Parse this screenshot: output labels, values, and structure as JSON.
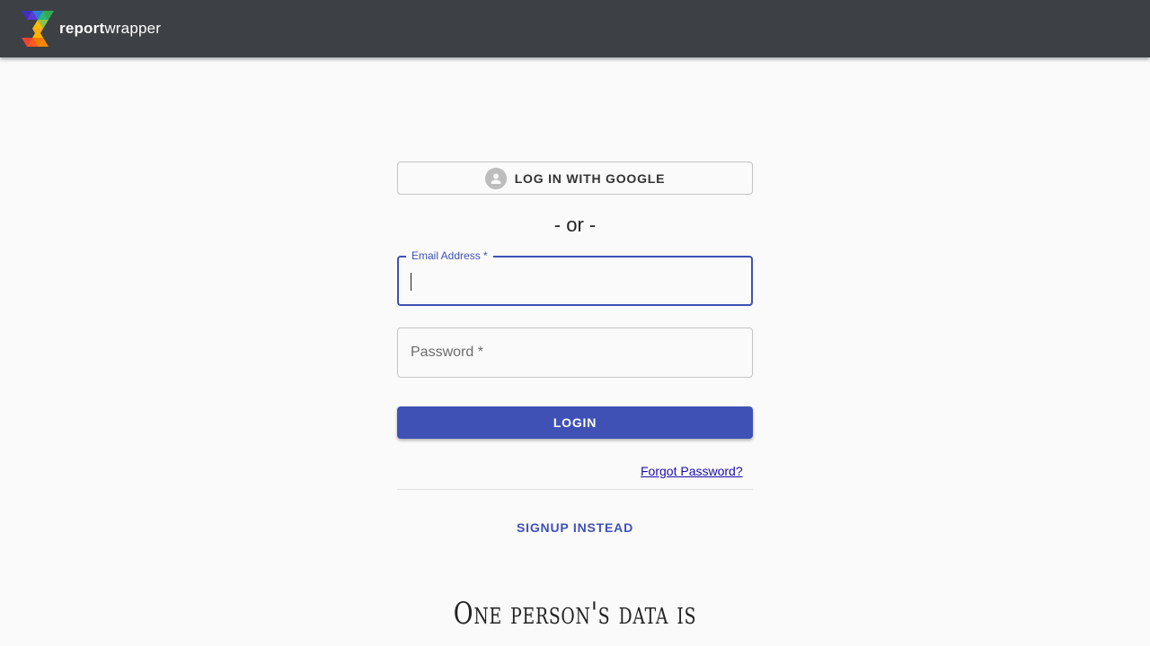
{
  "header": {
    "brand_bold": "report",
    "brand_light": "wrapper",
    "logo_colors": [
      "#3f2fbf",
      "#2e7bd6",
      "#34a853",
      "#fbbc05",
      "#ea4335",
      "#ff8a00"
    ]
  },
  "login": {
    "google_button_label": "LOG IN WITH GOOGLE",
    "google_button_icon": "account-circle-icon",
    "separator": "- or -",
    "email_label": "Email Address *",
    "email_value": "",
    "password_placeholder": "Password *",
    "login_button_label": "LOGIN",
    "forgot_link": "Forgot Password?",
    "signup_link": "SIGNUP INSTEAD"
  },
  "tagline": "One person's data is",
  "colors": {
    "primary": "#3f51b5",
    "header_bg": "#3d4044",
    "link": "#1a0dab"
  }
}
